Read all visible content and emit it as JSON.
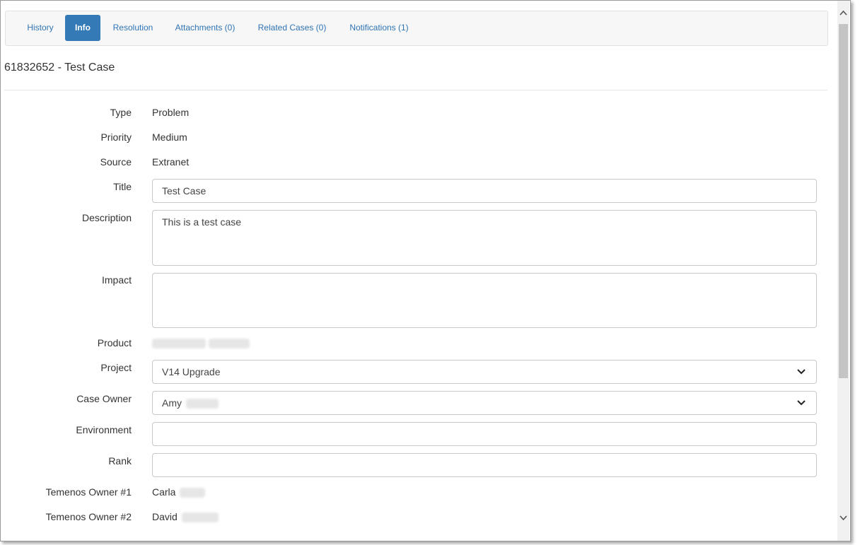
{
  "tabs": [
    {
      "label": "History",
      "active": false
    },
    {
      "label": "Info",
      "active": true
    },
    {
      "label": "Resolution",
      "active": false
    },
    {
      "label": "Attachments (0)",
      "active": false
    },
    {
      "label": "Related Cases (0)",
      "active": false
    },
    {
      "label": "Notifications (1)",
      "active": false
    }
  ],
  "case": {
    "heading": "61832652 - Test Case"
  },
  "fields": {
    "type": {
      "label": "Type",
      "value": "Problem"
    },
    "priority": {
      "label": "Priority",
      "value": "Medium"
    },
    "source": {
      "label": "Source",
      "value": "Extranet"
    },
    "title": {
      "label": "Title",
      "value": "Test Case"
    },
    "description": {
      "label": "Description",
      "value": "This is a test case"
    },
    "impact": {
      "label": "Impact",
      "value": ""
    },
    "product": {
      "label": "Product",
      "value": ""
    },
    "project": {
      "label": "Project",
      "value": "V14 Upgrade"
    },
    "case_owner": {
      "label": "Case Owner",
      "value": "Amy"
    },
    "environment": {
      "label": "Environment",
      "value": ""
    },
    "rank": {
      "label": "Rank",
      "value": ""
    },
    "owner1": {
      "label": "Temenos Owner #1",
      "value": "Carla"
    },
    "owner2": {
      "label": "Temenos Owner #2",
      "value": "David"
    }
  },
  "colors": {
    "accent": "#337ab7",
    "link": "#2f74b5"
  }
}
